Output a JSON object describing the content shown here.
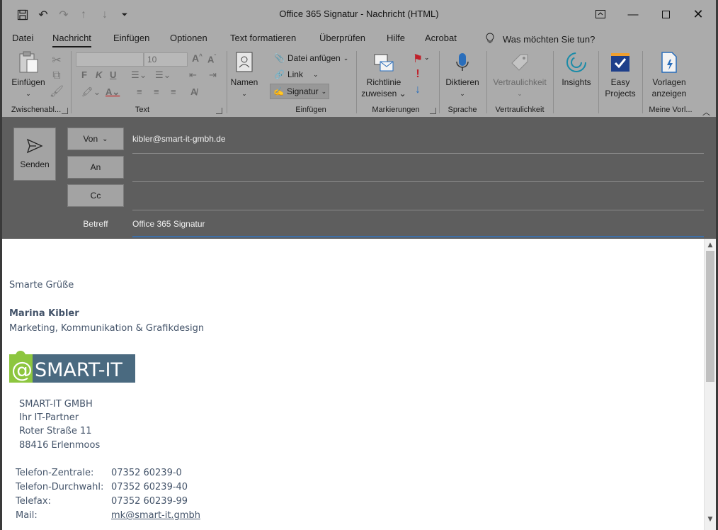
{
  "window": {
    "title": "Office 365 Signatur  -  Nachricht (HTML)"
  },
  "menu": {
    "tabs": [
      "Datei",
      "Nachricht",
      "Einfügen",
      "Optionen",
      "Text formatieren",
      "Überprüfen",
      "Hilfe",
      "Acrobat"
    ],
    "tell_me": "Was möchten Sie tun?"
  },
  "ribbon": {
    "einfuegen_label": "Einfügen",
    "font_size": "10",
    "datei_anfuegen": "Datei anfügen",
    "link": "Link",
    "signatur": "Signatur",
    "namen": "Namen",
    "richtlinie_line1": "Richtlinie",
    "richtlinie_line2": "zuweisen",
    "diktieren": "Diktieren",
    "vertraulichkeit": "Vertraulichkeit",
    "insights": "Insights",
    "easy_line1": "Easy",
    "easy_line2": "Projects",
    "vorlagen_line1": "Vorlagen",
    "vorlagen_line2": "anzeigen",
    "groups": {
      "zwischenablage": "Zwischenabl...",
      "text": "Text",
      "einfuegen": "Einfügen",
      "markierungen": "Markierungen",
      "sprache": "Sprache",
      "vertraulichkeit": "Vertraulichkeit",
      "meine_vorlagen": "Meine Vorl..."
    }
  },
  "compose": {
    "send": "Senden",
    "from_button": "Von",
    "from_value": "kibler@smart-it-gmbh.de",
    "to_button": "An",
    "cc_button": "Cc",
    "subject_label": "Betreff",
    "subject_value": "Office 365 Signatur"
  },
  "body": {
    "greeting": "Smarte Grüße",
    "name": "Marina Kibler",
    "role": "Marketing, Kommunikation & Grafikdesign",
    "logo_text": "SMART-IT",
    "address": [
      "SMART-IT GMBH",
      "Ihr IT-Partner",
      "Roter Straße 11",
      "88416 Erlenmoos"
    ],
    "contacts": [
      {
        "label": "Telefon-Zentrale:",
        "value": "07352 60239-0"
      },
      {
        "label": "Telefon-Durchwahl:",
        "value": "07352 60239-40"
      },
      {
        "label": "Telefax:",
        "value": "07352 60239-99"
      },
      {
        "label": "Mail:",
        "value": "mk@smart-it.gmbh"
      }
    ]
  },
  "colors": {
    "accent_green": "#8dc63f",
    "logo_blue": "#4a6a80",
    "text_slate": "#44546a"
  }
}
